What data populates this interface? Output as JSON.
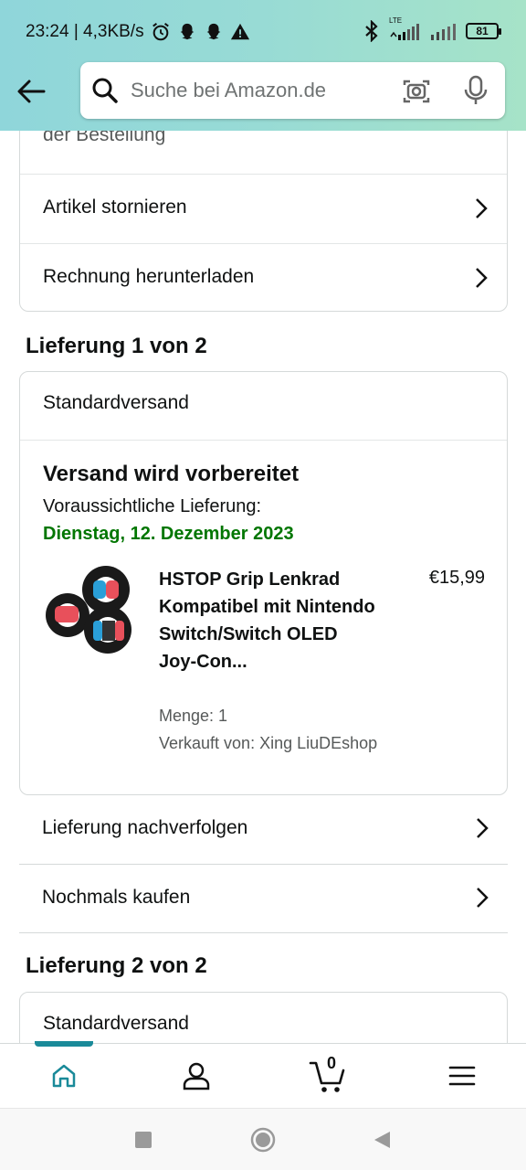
{
  "status_bar": {
    "time_speed": "23:24 | 4,3KB/s",
    "lte": "LTE",
    "battery": "81"
  },
  "search": {
    "placeholder": "Suche bei Amazon.de"
  },
  "top_card": {
    "partial_text": "der Bestellung",
    "items": [
      {
        "label": "Artikel stornieren"
      },
      {
        "label": "Rechnung herunterladen"
      }
    ]
  },
  "delivery1": {
    "title": "Lieferung 1 von 2",
    "shipping_method": "Standardversand",
    "status": "Versand wird vorbereitet",
    "eta_label": "Voraussichtliche Lieferung:",
    "eta_date": "Dienstag, 12. Dezember 2023",
    "product": {
      "title": "HSTOP Grip Lenkrad Kompatibel mit Nintendo Switch/Switch OLED Joy-Con...",
      "price": "€15,99",
      "quantity": "Menge: 1",
      "seller": "Verkauft von: Xing LiuDEshop"
    },
    "actions": [
      {
        "label": "Lieferung nachverfolgen"
      },
      {
        "label": "Nochmals kaufen"
      }
    ]
  },
  "delivery2": {
    "title": "Lieferung 2 von 2",
    "shipping_method": "Standardversand"
  },
  "bottom_nav": {
    "items": [
      "home-icon",
      "account-icon",
      "cart-icon",
      "menu-icon"
    ],
    "cart_count": "0",
    "active_color": "#1a8a99"
  },
  "colors": {
    "eta_green": "#007600",
    "header_gradient": [
      "#8fd6da",
      "#a6e3c8"
    ]
  }
}
